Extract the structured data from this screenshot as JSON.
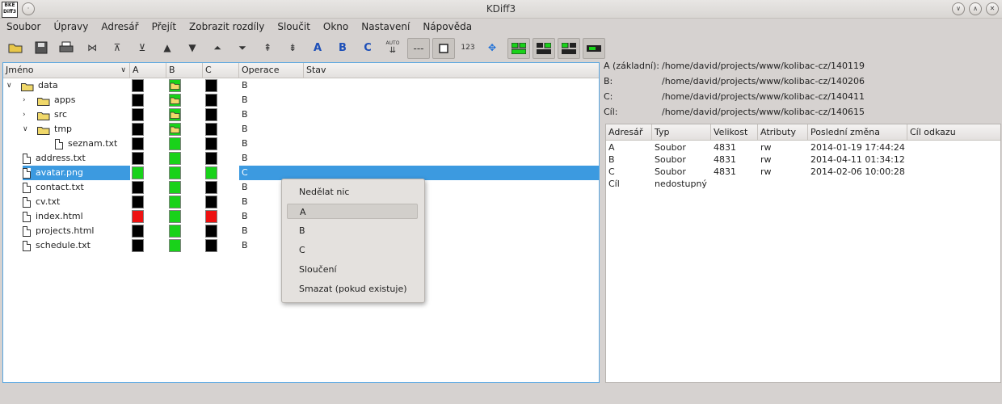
{
  "window": {
    "title": "KDiff3",
    "icon_text": "BKE\nDiff3"
  },
  "menu": [
    "Soubor",
    "Úpravy",
    "Adresář",
    "Přejít",
    "Zobrazit rozdíly",
    "Sloučit",
    "Okno",
    "Nastavení",
    "Nápověda"
  ],
  "toolbar": {
    "a_label": "A",
    "b_label": "B",
    "c_label": "C",
    "auto_label": "AUTO",
    "dash_label": "---",
    "num_label": "123"
  },
  "tree": {
    "headers": {
      "name": "Jméno",
      "a": "A",
      "b": "B",
      "c": "C",
      "operation": "Operace",
      "status": "Stav"
    },
    "rows": [
      {
        "name": "data",
        "type": "folder",
        "expanded": true,
        "a": "black",
        "b": "folder",
        "c": "black",
        "op": "B"
      },
      {
        "name": "apps",
        "type": "folder",
        "expanded": false,
        "a": "black",
        "b": "folder",
        "c": "black",
        "op": "B"
      },
      {
        "name": "src",
        "type": "folder",
        "expanded": false,
        "a": "black",
        "b": "folder",
        "c": "black",
        "op": "B"
      },
      {
        "name": "tmp",
        "type": "folder",
        "expanded": true,
        "a": "black",
        "b": "folder",
        "c": "black",
        "op": "B"
      },
      {
        "name": "seznam.txt",
        "type": "file",
        "a": "black",
        "b": "green",
        "c": "black",
        "op": "B"
      },
      {
        "name": "address.txt",
        "type": "file",
        "a": "black",
        "b": "green",
        "c": "black",
        "op": "B"
      },
      {
        "name": "avatar.png",
        "type": "file",
        "a": "green",
        "b": "green",
        "c": "green",
        "op": "C",
        "selected": true
      },
      {
        "name": "contact.txt",
        "type": "file",
        "a": "black",
        "b": "green",
        "c": "black",
        "op": "B"
      },
      {
        "name": "cv.txt",
        "type": "file",
        "a": "black",
        "b": "green",
        "c": "black",
        "op": "B"
      },
      {
        "name": "index.html",
        "type": "file",
        "a": "red",
        "b": "green",
        "c": "red",
        "op": "B"
      },
      {
        "name": "projects.html",
        "type": "file",
        "a": "black",
        "b": "green",
        "c": "black",
        "op": "B"
      },
      {
        "name": "schedule.txt",
        "type": "file",
        "a": "black",
        "b": "green",
        "c": "black",
        "op": "B"
      }
    ]
  },
  "context_menu": [
    "Nedělat nic",
    "A",
    "B",
    "C",
    "Sloučení",
    "Smazat (pokud existuje)"
  ],
  "info": [
    {
      "label": "A (základní):",
      "value": "/home/david/projects/www/kolibac-cz/140119"
    },
    {
      "label": "B:",
      "value": "/home/david/projects/www/kolibac-cz/140206"
    },
    {
      "label": "C:",
      "value": "/home/david/projects/www/kolibac-cz/140411"
    },
    {
      "label": "Cíl:",
      "value": "/home/david/projects/www/kolibac-cz/140615"
    }
  ],
  "details": {
    "headers": [
      "Adresář",
      "Typ",
      "Velikost",
      "Atributy",
      "Poslední změna",
      "Cíl odkazu"
    ],
    "rows": [
      [
        "A",
        "Soubor",
        "4831",
        "rw",
        "2014-01-19 17:44:24",
        ""
      ],
      [
        "B",
        "Soubor",
        "4831",
        "rw",
        "2014-04-11 01:34:12",
        ""
      ],
      [
        "C",
        "Soubor",
        "4831",
        "rw",
        "2014-02-06 10:00:28",
        ""
      ],
      [
        "Cíl",
        "nedostupný",
        "",
        "",
        "",
        ""
      ]
    ]
  },
  "colors": {
    "black": "#000000",
    "green": "#19d21a",
    "red": "#ee1111",
    "selection": "#3c9ae0"
  }
}
